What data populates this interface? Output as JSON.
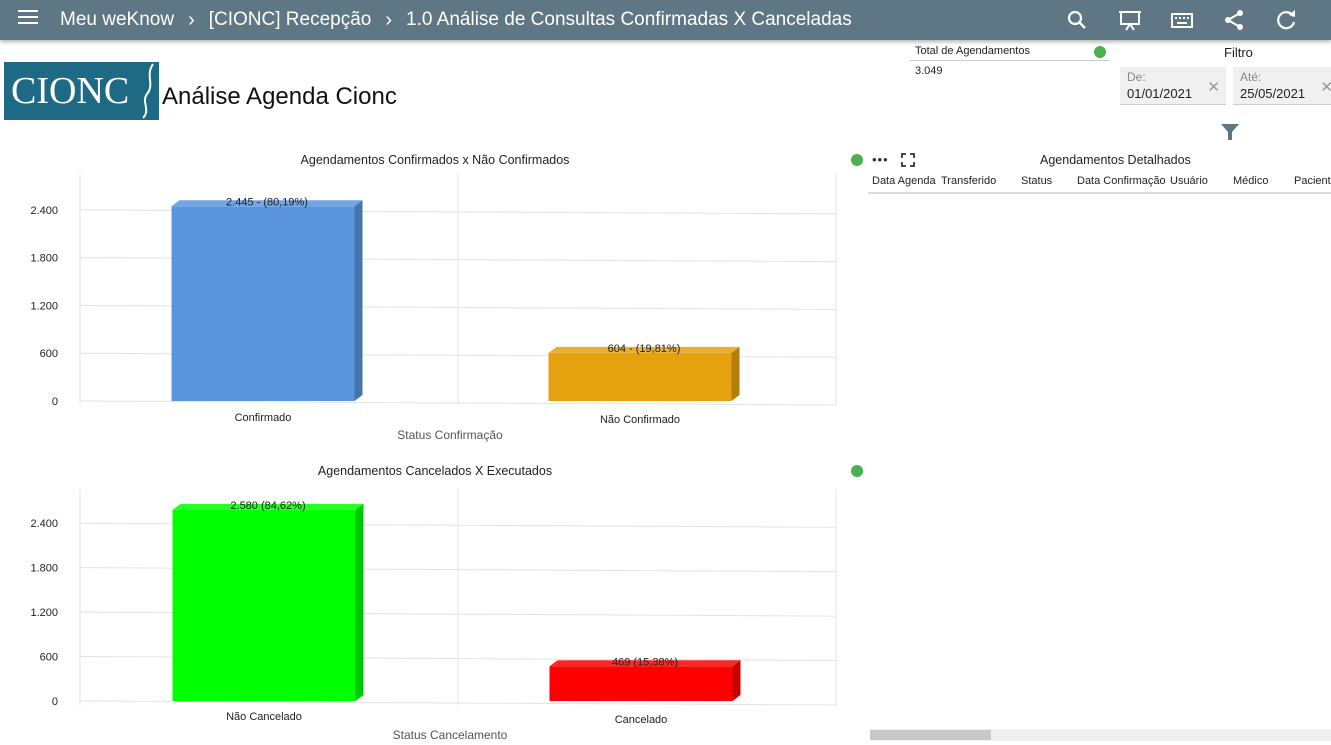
{
  "topbar": {
    "breadcrumb": [
      "Meu weKnow",
      "[CIONC] Recepção",
      "1.0 Análise de Consultas Confirmadas X Canceladas"
    ],
    "icons": [
      "search-icon",
      "presentation-icon",
      "keyboard-icon",
      "share-icon",
      "refresh-icon"
    ]
  },
  "header": {
    "logo_text": "CIONC",
    "title": "Análise Agenda Cionc"
  },
  "kpi": {
    "title": "Total de Agendamentos",
    "value": "3.049",
    "status_color": "#4caf50"
  },
  "filter": {
    "label": "Filtro",
    "from_label": "De:",
    "from_value": "01/01/2021",
    "to_label": "Até:",
    "to_value": "25/05/2021",
    "clear_glyph": "✕"
  },
  "chart_data": [
    {
      "type": "bar",
      "title": "Agendamentos Confirmados x Não Confirmados",
      "xlabel": "Status Confirmação",
      "ylabel": "",
      "categories": [
        "Confirmado",
        "Não Confirmado"
      ],
      "values": [
        2445,
        604
      ],
      "data_labels": [
        "2.445 - (80,19%)",
        "604 - (19,81%)"
      ],
      "colors": [
        "#5b95de",
        "#e6a10f"
      ],
      "yticks": [
        "0",
        "600",
        "1.200",
        "1.800",
        "2.400"
      ],
      "ylim": [
        0,
        2700
      ],
      "grid": true
    },
    {
      "type": "bar",
      "title": "Agendamentos Cancelados X Executados",
      "xlabel": "Status Cancelamento",
      "ylabel": "",
      "categories": [
        "Não Cancelado",
        "Cancelado"
      ],
      "values": [
        2580,
        469
      ],
      "data_labels": [
        "2.580 (84,62%)",
        "469 (15,38%)"
      ],
      "colors": [
        "#00ff00",
        "#ff0000"
      ],
      "yticks": [
        "0",
        "600",
        "1.200",
        "1.800",
        "2.400"
      ],
      "ylim": [
        0,
        2700
      ],
      "grid": true
    }
  ],
  "table": {
    "title": "Agendamentos Detalhados",
    "columns": [
      "Data Agenda",
      "Transferido",
      "Status",
      "Data Confirmação",
      "Usuário",
      "Médico",
      "Paciente"
    ],
    "more_glyph": "•••"
  }
}
